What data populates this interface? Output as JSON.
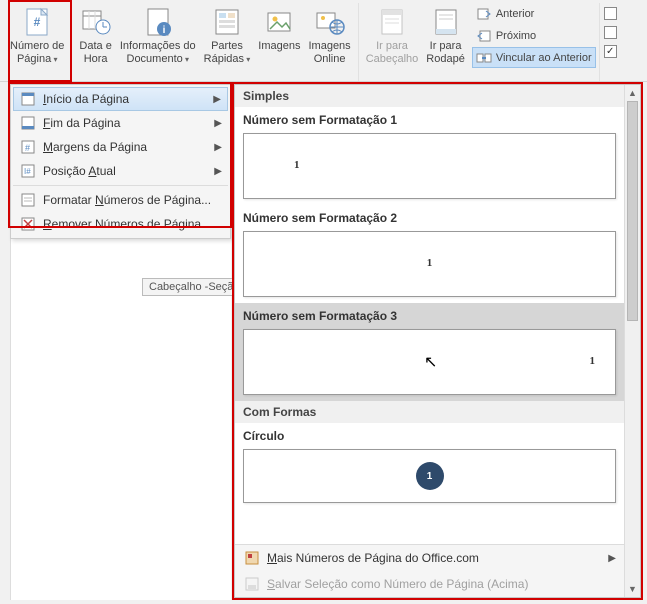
{
  "ribbon": {
    "page_number": {
      "label1": "Número de",
      "label2": "Página"
    },
    "date_time": {
      "label1": "Data e",
      "label2": "Hora"
    },
    "doc_info": {
      "label1": "Informações do",
      "label2": "Documento"
    },
    "quick_parts": {
      "label1": "Partes",
      "label2": "Rápidas"
    },
    "images": {
      "label": "Imagens"
    },
    "online_images": {
      "label1": "Imagens",
      "label2": "Online"
    },
    "goto_header": {
      "label1": "Ir para",
      "label2": "Cabeçalho"
    },
    "goto_footer": {
      "label1": "Ir para",
      "label2": "Rodapé"
    },
    "previous": "Anterior",
    "next": "Próximo",
    "link_previous": "Vincular ao Anterior"
  },
  "menu": {
    "top_of_page": "Início da Página",
    "bottom_of_page": "Fim da Página",
    "margins": "Margens da Página",
    "current_pos": "Posição Atual",
    "format": "Formatar Números de Página...",
    "remove": "Remover Números de Página"
  },
  "gallery": {
    "section_simple": "Simples",
    "plain1": "Número sem Formatação 1",
    "plain2": "Número sem Formatação 2",
    "plain3": "Número sem Formatação 3",
    "section_shapes": "Com Formas",
    "circle": "Círculo",
    "sample_number": "1",
    "more": "Mais Números de Página do Office.com",
    "save_selection": "Salvar Seleção como Número de Página (Acima)"
  },
  "doc": {
    "section_label": "Cabeçalho -Seçã"
  }
}
